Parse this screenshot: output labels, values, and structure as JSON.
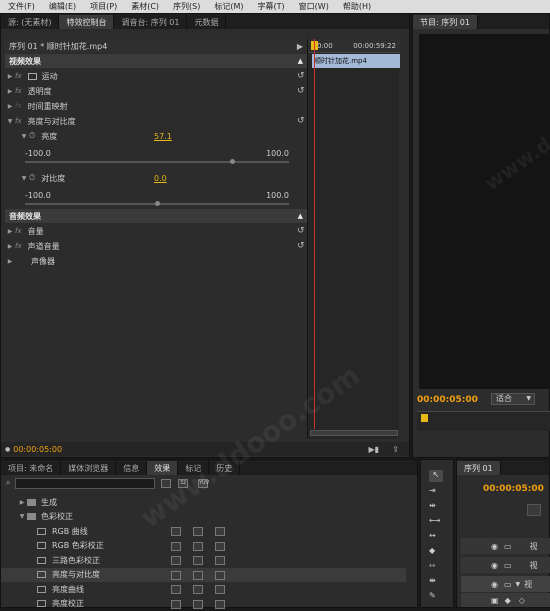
{
  "menubar": [
    "文件(F)",
    "编辑(E)",
    "项目(P)",
    "素材(C)",
    "序列(S)",
    "标记(M)",
    "字幕(T)",
    "窗口(W)",
    "帮助(H)"
  ],
  "top_tabs": [
    "源: (无素材)",
    "特效控制台",
    "调音台: 序列 01",
    "元数据"
  ],
  "program_tab": "节目: 序列 01",
  "effect_controls": {
    "clip_title": "序列 01 * 顺时针加花.mp4",
    "time_start": "0:00",
    "time_end": "00:00:59:22",
    "clip_name": "顺时针加花.mp4",
    "video_effects": "视频效果",
    "motion": "运动",
    "opacity": "透明度",
    "time_remap": "时间重映射",
    "brightness_contrast": "亮度与对比度",
    "brightness": "亮度",
    "brightness_value": "57.1",
    "contrast": "对比度",
    "contrast_value": "0.0",
    "min": "-100.0",
    "max": "100.0",
    "audio_effects": "音频效果",
    "volume": "音量",
    "channel_volume": "声道音量",
    "panner": "声像器",
    "timecode": "00:00:05:00",
    "brightness_fraction": 0.785,
    "contrast_fraction": 0.5
  },
  "program": {
    "timecode": "00:00:05:00",
    "fit": "适合"
  },
  "project_tabs": [
    "项目: 未命名",
    "媒体浏览器",
    "信息",
    "效果",
    "标记",
    "历史"
  ],
  "effects_list": [
    {
      "label": "生成",
      "type": "folder",
      "indent": 1
    },
    {
      "label": "色彩校正",
      "type": "folder",
      "indent": 1
    },
    {
      "label": "RGB 曲线",
      "type": "effect",
      "indent": 2
    },
    {
      "label": "RGB 色彩校正",
      "type": "effect",
      "indent": 2
    },
    {
      "label": "三路色彩校正",
      "type": "effect",
      "indent": 2
    },
    {
      "label": "亮度与对比度",
      "type": "effect",
      "indent": 2,
      "selected": true
    },
    {
      "label": "亮度曲线",
      "type": "effect",
      "indent": 2
    },
    {
      "label": "亮度校正",
      "type": "effect",
      "indent": 2
    }
  ],
  "search_badges": [
    "32",
    "YUV"
  ],
  "timeline": {
    "tab": "序列 01",
    "timecode": "00:00:05:00",
    "track_label": "视"
  }
}
